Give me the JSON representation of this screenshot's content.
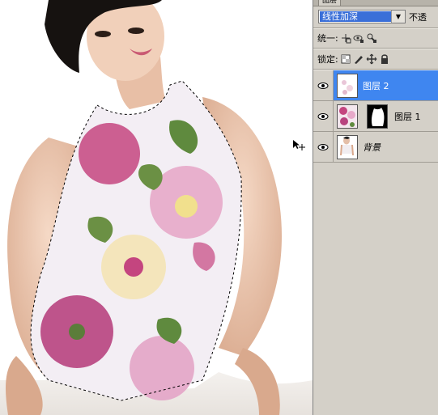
{
  "panel": {
    "tab_label": "图层",
    "blend_mode": "线性加深",
    "opacity_label": "不透",
    "unify_label": "统一:",
    "lock_label": "锁定:",
    "layers": [
      {
        "name": "图层 2",
        "selected": true,
        "visible": true
      },
      {
        "name": "图层 1",
        "selected": false,
        "visible": true,
        "has_mask": true
      },
      {
        "name": "背景",
        "selected": false,
        "visible": true,
        "italic": true
      }
    ]
  },
  "colors": {
    "selection_highlight": "#3f86f0",
    "blend_highlight": "#3a6fd8",
    "panel_bg": "#d4d0c8"
  },
  "icons": [
    "eye-icon",
    "lock-transparency-icon",
    "lock-paint-icon",
    "lock-move-icon",
    "lock-all-icon",
    "move-cursor-icon",
    "unify-position-icon",
    "unify-visibility-icon",
    "unify-style-icon"
  ]
}
